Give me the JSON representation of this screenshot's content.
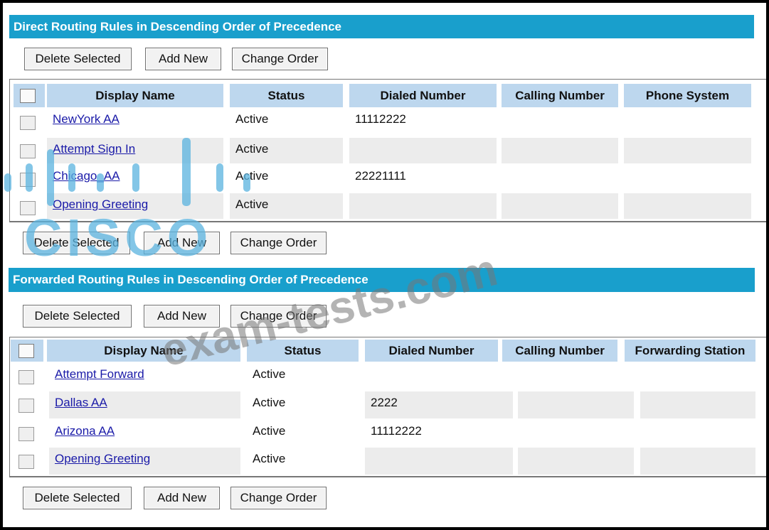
{
  "direct": {
    "title": "Direct Routing Rules in Descending Order of Precedence",
    "buttons": {
      "delete": "Delete Selected",
      "add": "Add New",
      "change": "Change Order"
    },
    "columns": [
      "Display Name",
      "Status",
      "Dialed Number",
      "Calling Number",
      "Phone System"
    ],
    "rows": [
      {
        "name": "NewYork AA",
        "status": "Active",
        "dialed": "11112222",
        "calling": "",
        "system": ""
      },
      {
        "name": "Attempt Sign In",
        "status": "Active",
        "dialed": "",
        "calling": "",
        "system": ""
      },
      {
        "name": "Chicago_AA",
        "status": "Active",
        "dialed": "22221111",
        "calling": "",
        "system": ""
      },
      {
        "name": "Opening Greeting",
        "status": "Active",
        "dialed": "",
        "calling": "",
        "system": ""
      }
    ]
  },
  "forwarded": {
    "title": "Forwarded Routing Rules in Descending Order of Precedence",
    "buttons": {
      "delete": "Delete Selected",
      "add": "Add New",
      "change": "Change Order"
    },
    "columns": [
      "Display Name",
      "Status",
      "Dialed Number",
      "Calling Number",
      "Forwarding Station"
    ],
    "rows": [
      {
        "name": "Attempt Forward",
        "status": "Active",
        "dialed": "",
        "calling": "",
        "station": ""
      },
      {
        "name": "Dallas AA",
        "status": "Active",
        "dialed": "2222",
        "calling": "",
        "station": ""
      },
      {
        "name": "Arizona AA",
        "status": "Active",
        "dialed": "11112222",
        "calling": "",
        "station": ""
      },
      {
        "name": "Opening Greeting",
        "status": "Active",
        "dialed": "",
        "calling": "",
        "station": ""
      }
    ]
  },
  "watermark": {
    "logo": "CISCO",
    "site": "exam-tests.com"
  }
}
